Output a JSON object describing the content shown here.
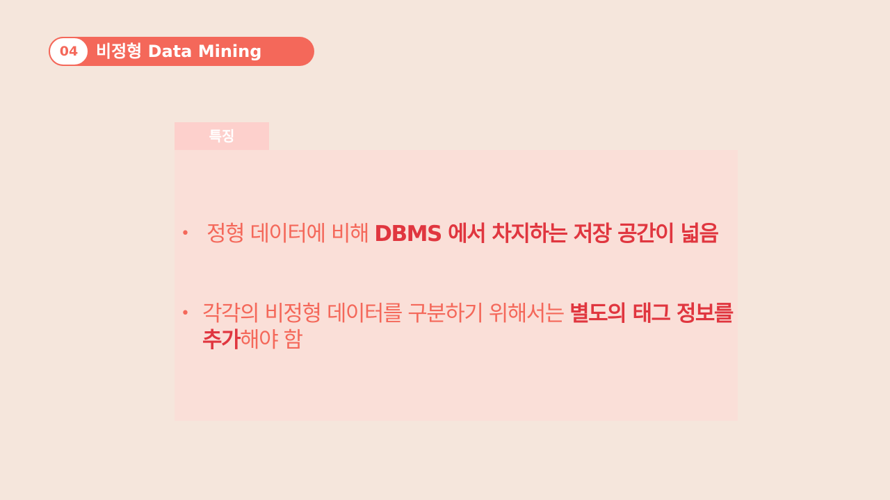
{
  "header": {
    "number": "04",
    "title": "비정형 Data Mining"
  },
  "section": {
    "tab_label": "특징"
  },
  "bullets": [
    {
      "dot": "•",
      "normal1": "정형 데이터에 비해 ",
      "highlight1": "DBMS 에서 차지하는 저장 공간이 넓음"
    },
    {
      "dot": "•",
      "normal1": "각각의 비정형 데이터를 구분하기 위해서는 ",
      "highlight1": "별도의 태그 정보를 추가",
      "normal2": "해야  함"
    }
  ],
  "colors": {
    "background": "#f5e6dc",
    "accent": "#f4685a",
    "highlight": "#e0363f",
    "panel": "#fadfd8",
    "tab": "#fdd0cc"
  }
}
